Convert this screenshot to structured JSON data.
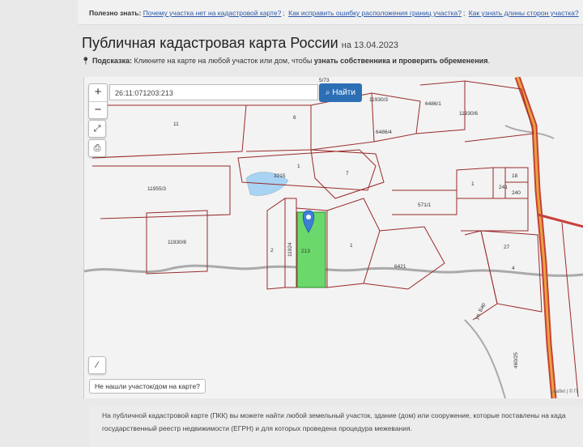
{
  "banner": {
    "prefix": "Полезно знать:",
    "links": [
      "Почему участка нет на кадастровой карте?",
      "Как исправить ошибку расположения границ участка?",
      "Как узнать длины сторон участка?"
    ],
    "separator": ";"
  },
  "page": {
    "title": "Публичная кадастровая карта России",
    "date": "на 13.04.2023"
  },
  "hint": {
    "label": "Подсказка:",
    "text": "Кликните на карте на любой участок или дом, чтобы",
    "bold": "узнать собственника и проверить обременения",
    "end": "."
  },
  "map": {
    "zoom_in": "+",
    "zoom_out": "−",
    "search_value": "26:11:071203:213",
    "find_label": "Найти",
    "not_found_label": "Не нашли участок/дом на карте?",
    "attribution": "Leaflet | © П",
    "parcel_labels": [
      "11",
      "6",
      "11930/3",
      "6486/1",
      "11930/6",
      "6486/4",
      "1",
      "3215",
      "7",
      "11955/3",
      "1",
      "241",
      "18",
      "240",
      "571/1",
      "11930/8",
      "2",
      "11924",
      "213",
      "1",
      "6421",
      "27",
      "4",
      "460/25",
      "5/73"
    ],
    "road_label": "ул. Бар",
    "highlight_color": "#6bd86b"
  },
  "footer": {
    "line1": "На публичной кадастровой карте (ПКК) вы можете найти любой земельный участок, здание (дом) или сооружение, которые поставлены на када",
    "line2": "государственный реестр недвижимости (ЕГРН) и для которых проведена процедура межевания."
  }
}
